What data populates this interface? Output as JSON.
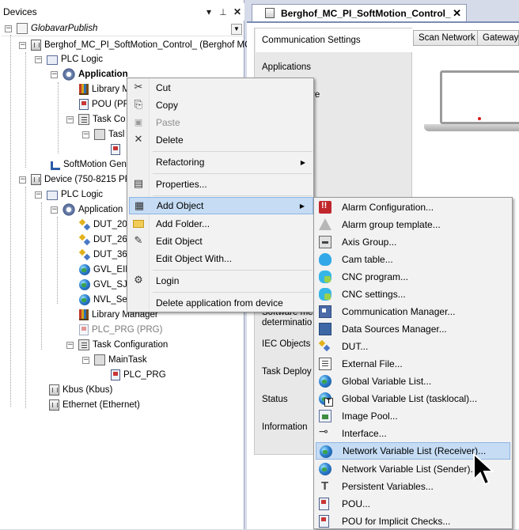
{
  "devices_panel": {
    "title": "Devices",
    "pin_glyph": "ᵖ",
    "dropdown_glyph": "▾",
    "close_glyph": "✕",
    "combo_arrow": "▼",
    "tree": [
      {
        "label": "GlobavarPublish",
        "italic": true
      },
      {
        "label": "Berghof_MC_PI_SoftMotion_Control_ (Berghof MC-"
      },
      {
        "label": "PLC Logic"
      },
      {
        "label": "Application"
      },
      {
        "label": "Library M"
      },
      {
        "label": "POU (PR"
      },
      {
        "label": "Task Co"
      },
      {
        "label": "Tasl"
      },
      {
        "label": "SoftMotion Gene"
      },
      {
        "label": "Device (750-8215 PF"
      },
      {
        "label": "PLC Logic"
      },
      {
        "label": "Application"
      },
      {
        "label": "DUT_20"
      },
      {
        "label": "DUT_26"
      },
      {
        "label": "DUT_36"
      },
      {
        "label": "GVL_EIP"
      },
      {
        "label": "GVL_SJ1"
      },
      {
        "label": "NVL_Ser"
      },
      {
        "label": "Library Manager"
      },
      {
        "label": "PLC_PRG (PRG)"
      },
      {
        "label": "Task Configuration"
      },
      {
        "label": "MainTask"
      },
      {
        "label": "PLC_PRG"
      },
      {
        "label": "Kbus (Kbus)"
      },
      {
        "label": "Ethernet (Ethernet)"
      }
    ]
  },
  "editor": {
    "tab_label": "Berghof_MC_PI_SoftMotion_Control_",
    "tab_close": "✕",
    "nav_items": [
      "Communication Settings",
      "Applications",
      "Restore",
      "Software me",
      "determinatio",
      "IEC Objects",
      "Task Deploy",
      "Status",
      "Information"
    ],
    "scan_network": "Scan Network",
    "gateway": "Gateway"
  },
  "context_menu": {
    "items": [
      {
        "label": "Cut",
        "icon": "✂"
      },
      {
        "label": "Copy",
        "icon": "⎘"
      },
      {
        "label": "Paste",
        "icon": "📋"
      },
      {
        "label": "Delete",
        "icon": "✕"
      },
      {
        "label": "Refactoring",
        "arrow": "▶"
      },
      {
        "label": "Properties...",
        "icon": "▤"
      },
      {
        "label": "Add Object",
        "icon": "▦",
        "arrow": "▶"
      },
      {
        "label": "Add Folder...",
        "icon": "📁"
      },
      {
        "label": "Edit Object",
        "icon": "✎"
      },
      {
        "label": "Edit Object With..."
      },
      {
        "label": "Login",
        "icon": "⚙"
      },
      {
        "label": "Delete application from device"
      }
    ]
  },
  "submenu": {
    "items": [
      {
        "label": "Alarm Configuration..."
      },
      {
        "label": "Alarm group template..."
      },
      {
        "label": "Axis Group..."
      },
      {
        "label": "Cam table..."
      },
      {
        "label": "CNC program..."
      },
      {
        "label": "CNC settings..."
      },
      {
        "label": "Communication Manager..."
      },
      {
        "label": "Data Sources Manager..."
      },
      {
        "label": "DUT..."
      },
      {
        "label": "External File..."
      },
      {
        "label": "Global Variable List..."
      },
      {
        "label": "Global Variable List (tasklocal)..."
      },
      {
        "label": "Image Pool..."
      },
      {
        "label": "Interface..."
      },
      {
        "label": "Network Variable List (Receiver)..."
      },
      {
        "label": "Network Variable List (Sender)..."
      },
      {
        "label": "Persistent Variables..."
      },
      {
        "label": "POU..."
      },
      {
        "label": "POU for Implicit Checks..."
      }
    ]
  },
  "colors": {
    "highlight": "#c5dcf4",
    "highlight_border": "#8fb6e3",
    "panel_border": "#7b8cb3"
  }
}
